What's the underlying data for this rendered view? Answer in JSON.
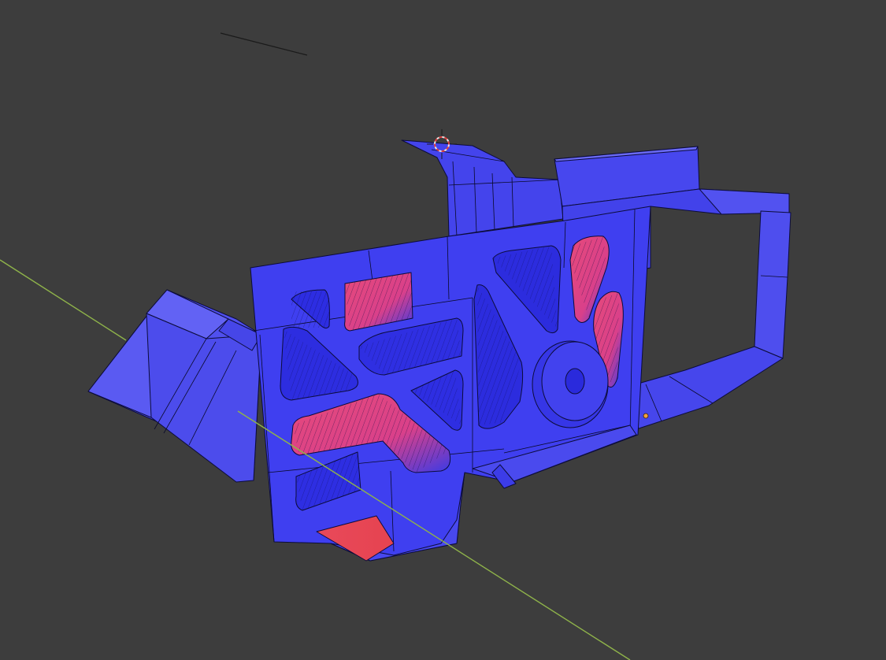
{
  "viewport": {
    "background": "#3d3d3d",
    "grid_x_axis_color": "#8fb34a",
    "mesh_face_color": "#3e3ef2",
    "mesh_face_light": "#5454f0",
    "mesh_face_dark": "#2f2fd8",
    "flipped_normal_color": "#e64a55",
    "edge_color": "#0c0c3a"
  },
  "gizmos": {
    "cursor_icon": "3d-cursor-icon",
    "origin_icon": "object-origin-dot"
  }
}
